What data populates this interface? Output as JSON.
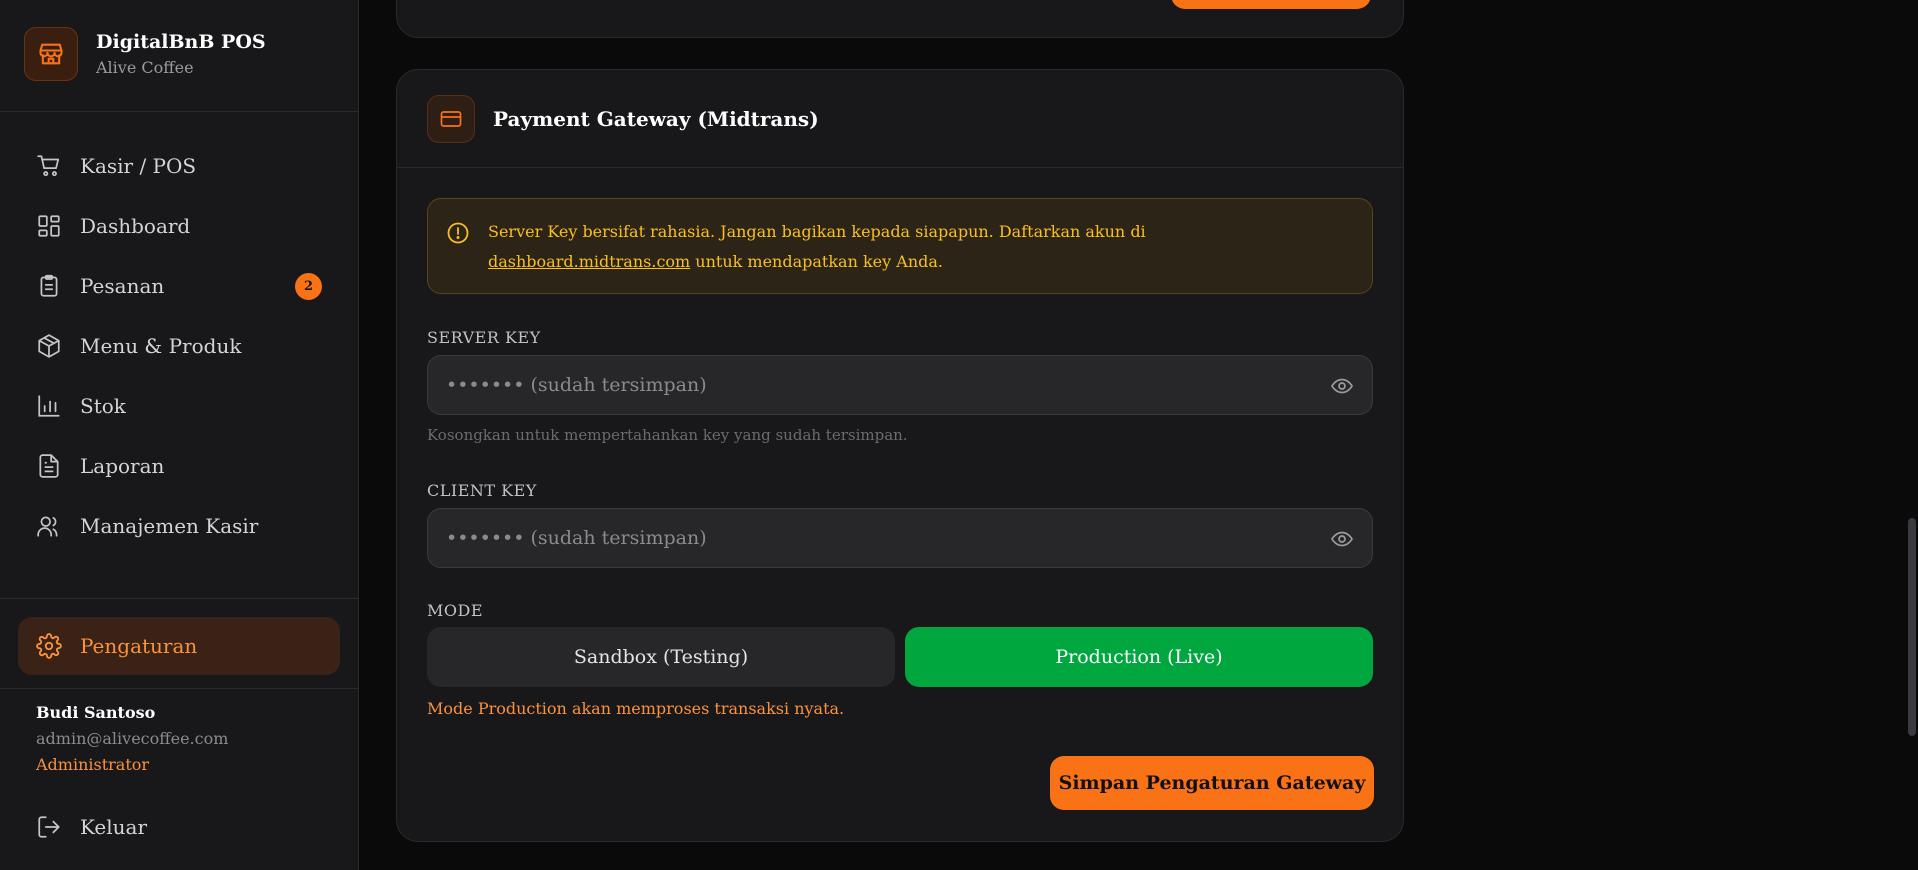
{
  "brand": {
    "title": "DigitalBnB POS",
    "subtitle": "Alive Coffee"
  },
  "nav": {
    "items": [
      {
        "label": "Kasir / POS",
        "icon": "cart-icon"
      },
      {
        "label": "Dashboard",
        "icon": "dashboard-icon"
      },
      {
        "label": "Pesanan",
        "icon": "clipboard-icon",
        "badge": "2"
      },
      {
        "label": "Menu & Produk",
        "icon": "box-icon"
      },
      {
        "label": "Stok",
        "icon": "bar-chart-icon"
      },
      {
        "label": "Laporan",
        "icon": "document-icon"
      },
      {
        "label": "Manajemen Kasir",
        "icon": "users-icon"
      }
    ],
    "settings_label": "Pengaturan",
    "logout_label": "Keluar"
  },
  "user": {
    "name": "Budi Santoso",
    "email": "admin@alivecoffee.com",
    "role": "Administrator"
  },
  "gateway": {
    "title": "Payment Gateway (Midtrans)",
    "alert_prefix": "Server Key bersifat rahasia. Jangan bagikan kepada siapapun. Daftarkan akun di ",
    "alert_link": "dashboard.midtrans.com",
    "alert_suffix": " untuk mendapatkan key Anda.",
    "server_key_label": "SERVER KEY",
    "server_key_placeholder": "••••••• (sudah tersimpan)",
    "server_key_hint": "Kosongkan untuk mempertahankan key yang sudah tersimpan.",
    "client_key_label": "CLIENT KEY",
    "client_key_placeholder": "••••••• (sudah tersimpan)",
    "mode_label": "MODE",
    "mode_sandbox": "Sandbox (Testing)",
    "mode_production": "Production (Live)",
    "mode_selected": "Production (Live)",
    "mode_note": "Mode Production akan memproses transaksi nyata.",
    "save_label": "Simpan Pengaturan Gateway"
  },
  "colors": {
    "accent": "#f97316",
    "success": "#00a63e",
    "warning": "#fbbf24"
  }
}
